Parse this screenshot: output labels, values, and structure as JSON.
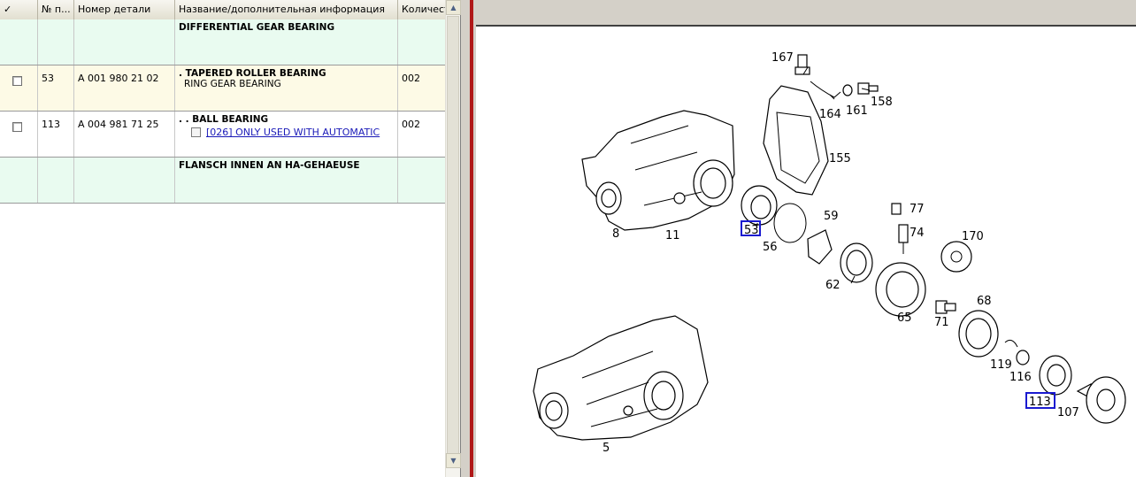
{
  "grid": {
    "headers": [
      "✓",
      "№ п...",
      "Номер детали",
      "Название/дополнительная информация",
      "Количестве..."
    ],
    "rows": [
      {
        "kind": "heading",
        "pos": "",
        "part_number": "",
        "name": "DIFFERENTIAL GEAR BEARING",
        "sub": "",
        "qty": ""
      },
      {
        "kind": "item",
        "pos": "53",
        "part_number": "A 001 980 21 02",
        "name": ". TAPERED ROLLER BEARING",
        "sub": "RING GEAR BEARING",
        "qty": "002"
      },
      {
        "kind": "item",
        "pos": "113",
        "part_number": "A 004 981 71 25",
        "name": ". . BALL BEARING",
        "note": "[026] ONLY USED WITH AUTOMATIC",
        "qty": "002"
      },
      {
        "kind": "heading",
        "pos": "",
        "part_number": "",
        "name": "FLANSCH INNEN AN HA-GEHAEUSE",
        "sub": "",
        "qty": ""
      }
    ]
  },
  "scrollbar": {
    "up_arrow": "▲",
    "down_arrow": "▼"
  },
  "diagram": {
    "labels": [
      "167",
      "164",
      "161",
      "158",
      "155",
      "8",
      "11",
      "53",
      "56",
      "59",
      "77",
      "74",
      "170",
      "62",
      "65",
      "71",
      "68",
      "119",
      "116",
      "113",
      "107",
      "5"
    ],
    "highlighted": [
      "53",
      "113"
    ]
  },
  "colors": {
    "heading_row": "#e9fbf0",
    "selected_row": "#fdfae6",
    "hotspot": "#1a1ad0",
    "splitter_accent": "#b01818"
  }
}
